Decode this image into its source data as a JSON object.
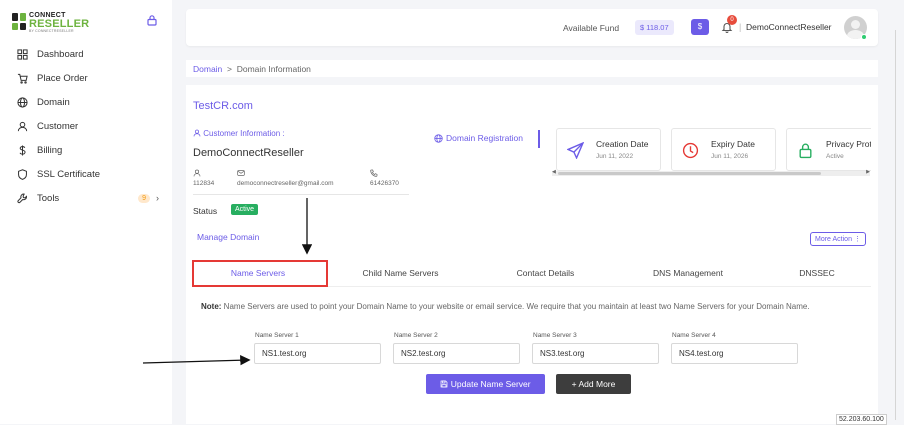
{
  "logo": {
    "top": "CONNECT",
    "main": "RESELLER",
    "sub": "BY CONNECTRESELLER"
  },
  "sidebar": {
    "items": [
      {
        "label": "Dashboard",
        "icon": "dashboard-icon"
      },
      {
        "label": "Place Order",
        "icon": "cart-icon"
      },
      {
        "label": "Domain",
        "icon": "globe-icon"
      },
      {
        "label": "Customer",
        "icon": "user-icon"
      },
      {
        "label": "Billing",
        "icon": "dollar-icon"
      },
      {
        "label": "SSL Certificate",
        "icon": "shield-icon"
      },
      {
        "label": "Tools",
        "icon": "wrench-icon",
        "badge": "9"
      }
    ]
  },
  "header": {
    "fund_label": "Available Fund",
    "fund_value": "$ 118.07",
    "dollar_button": "$",
    "notification_count": "0",
    "separator": "|",
    "user_name": "DemoConnectReseller"
  },
  "breadcrumb": {
    "root": "Domain",
    "sep": ">",
    "current": "Domain Information"
  },
  "domain": {
    "name": "TestCR.com",
    "customer_label": "Customer Information :",
    "customer_name": "DemoConnectReseller",
    "customer_id": "112834",
    "customer_email": "democonnectreseller@gmail.com",
    "customer_phone": "61426370",
    "status_label": "Status",
    "status_value": "Active",
    "manage_label": "Manage Domain",
    "registration_label": "Domain Registration",
    "more_action": "More Action ⋮"
  },
  "cards": [
    {
      "title": "Creation Date",
      "value": "Jun 11, 2022",
      "icon": "send-icon",
      "color": "#6c5ce7"
    },
    {
      "title": "Expiry Date",
      "value": "Jun 11, 2026",
      "icon": "clock-icon",
      "color": "#e53935"
    },
    {
      "title": "Privacy Protection",
      "value": "Active",
      "icon": "lock-icon",
      "color": "#27ae60"
    }
  ],
  "tabs": [
    {
      "label": "Name Servers",
      "active": true
    },
    {
      "label": "Child Name Servers"
    },
    {
      "label": "Contact Details"
    },
    {
      "label": "DNS Management"
    },
    {
      "label": "DNSSEC"
    }
  ],
  "note": {
    "bold": "Note:",
    "text": " Name Servers are used to point your Domain Name to your website or email service. We require that you maintain at least two Name Servers for your Domain Name."
  },
  "nameservers": [
    {
      "label": "Name Server 1",
      "value": "NS1.test.org"
    },
    {
      "label": "Name Server 2",
      "value": "NS2.test.org"
    },
    {
      "label": "Name Server 3",
      "value": "NS3.test.org"
    },
    {
      "label": "Name Server 4",
      "value": "NS4.test.org"
    }
  ],
  "buttons": {
    "update": "Update Name Server",
    "add_more": "+ Add More"
  },
  "ip_badge": "52.203.60.100",
  "colors": {
    "accent": "#6c5ce7",
    "success": "#27ae60",
    "danger": "#e53935",
    "dark_button": "#3d3d3d"
  }
}
